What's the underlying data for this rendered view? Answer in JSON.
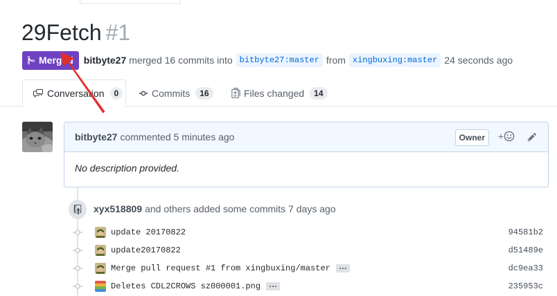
{
  "pr": {
    "title": "29Fetch",
    "number": "#1",
    "state": "Merged",
    "author": "bitbyte27",
    "merged_text": "merged 16 commits into",
    "base_branch": "bitbyte27:master",
    "from_text": "from",
    "head_branch": "xingbuxing:master",
    "time_ago": "24 seconds ago"
  },
  "tabs": [
    {
      "label": "Conversation",
      "count": "0",
      "icon": "comment-discussion-icon"
    },
    {
      "label": "Commits",
      "count": "16",
      "icon": "git-commit-icon"
    },
    {
      "label": "Files changed",
      "count": "14",
      "icon": "file-diff-icon"
    }
  ],
  "comment": {
    "author": "bitbyte27",
    "action": "commented",
    "time": "5 minutes ago",
    "role": "Owner",
    "reaction_plus": "+",
    "body": "No description provided."
  },
  "commits_event": {
    "author": "xyx518809",
    "text": "and others added some commits",
    "time": "7 days ago"
  },
  "commits": [
    {
      "message": "update 20170822",
      "sha": "94581b2",
      "has_more": false
    },
    {
      "message": "update20170822",
      "sha": "d51489e",
      "has_more": false
    },
    {
      "message": "Merge pull request #1 from xingbuxing/master",
      "sha": "dc9ea33",
      "has_more": true
    },
    {
      "message": "Deletes CDL2CROWS sz000001.png",
      "sha": "235953c",
      "has_more": true
    }
  ],
  "colors": {
    "merged": "#6f42c1",
    "branch_bg": "#eaf5ff",
    "branch_fg": "#0366d6",
    "comment_header_bg": "#f1f8ff",
    "annotation_arrow": "#e0302d"
  }
}
